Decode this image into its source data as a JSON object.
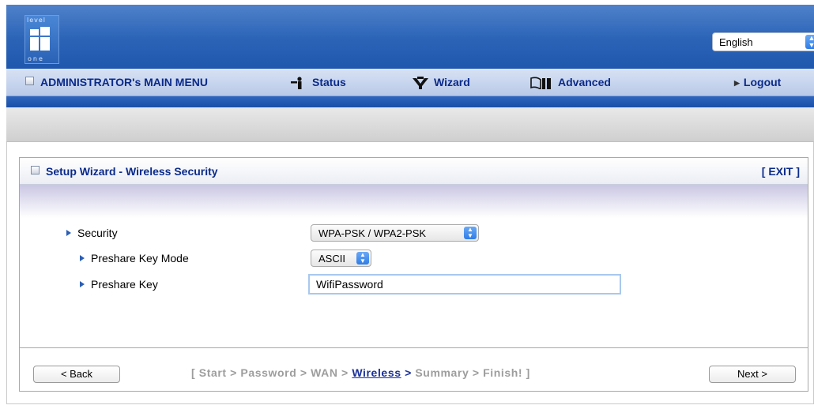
{
  "header": {
    "logo": {
      "top": "level",
      "bottom": "one"
    },
    "language": {
      "selected": "English"
    }
  },
  "menu": {
    "main": "ADMINISTRATOR's MAIN MENU",
    "status": "Status",
    "wizard": "Wizard",
    "advanced": "Advanced",
    "logout": "Logout"
  },
  "panel": {
    "title": "Setup Wizard - Wireless Security",
    "exit": "[ EXIT ]",
    "fields": {
      "security_label": "Security",
      "security_value": "WPA-PSK / WPA2-PSK",
      "mode_label": "Preshare Key Mode",
      "mode_value": "ASCII",
      "key_label": "Preshare Key",
      "key_value": "WifiPassword"
    }
  },
  "footer": {
    "back": "< Back",
    "next": "Next >",
    "steps": {
      "prefix": "[ Start > Password > WAN > ",
      "current": "Wireless",
      "arrow": " >",
      "suffix": " Summary > Finish! ]"
    }
  }
}
